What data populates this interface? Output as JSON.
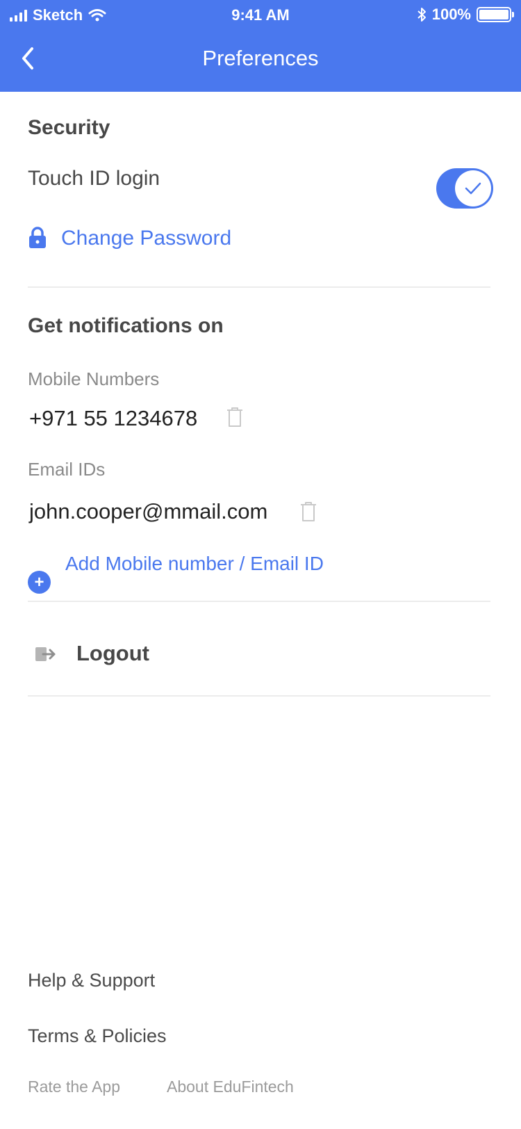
{
  "status_bar": {
    "carrier": "Sketch",
    "time": "9:41 AM",
    "battery": "100%"
  },
  "nav": {
    "title": "Preferences",
    "back_icon": "chevron-left-icon"
  },
  "security": {
    "title": "Security",
    "touch_id_label": "Touch ID login",
    "touch_id_enabled": true,
    "change_password_label": "Change Password"
  },
  "notifications": {
    "title": "Get notifications on",
    "mobile_label": "Mobile Numbers",
    "mobile_numbers": [
      "+971 55 1234678"
    ],
    "email_label": "Email IDs",
    "emails": [
      "john.cooper@mmail.com"
    ],
    "add_label": "Add Mobile number / Email ID"
  },
  "logout": {
    "label": "Logout"
  },
  "footer": {
    "help": "Help & Support",
    "terms": "Terms & Policies",
    "rate": "Rate the App",
    "about": "About EduFintech"
  },
  "colors": {
    "accent": "#4a78ee",
    "text_dark": "#474747",
    "text_muted": "#8a8a8a",
    "divider": "#ececec"
  }
}
